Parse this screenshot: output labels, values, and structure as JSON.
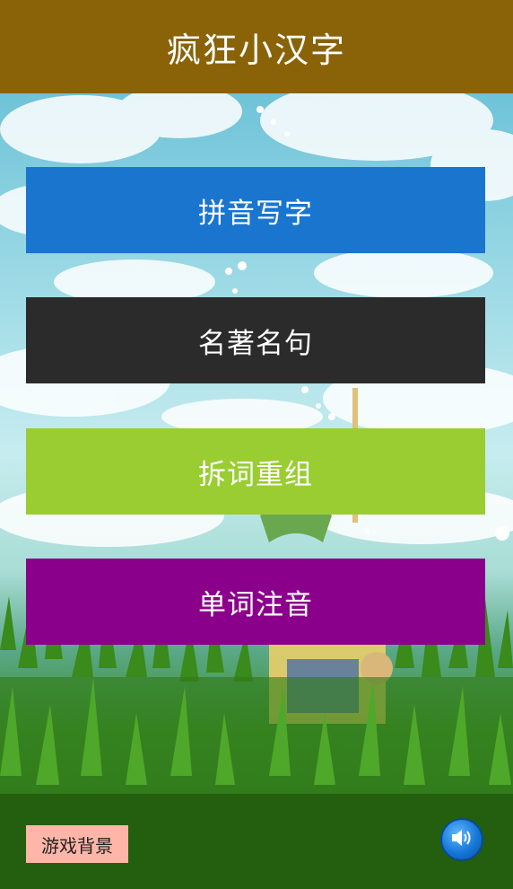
{
  "header": {
    "title": "疯狂小汉字",
    "color": "#8a6309"
  },
  "menu": {
    "items": [
      {
        "label": "拼音写字",
        "color": "#1a75cf"
      },
      {
        "label": "名著名句",
        "color": "#2b2b2b"
      },
      {
        "label": "拆词重组",
        "color": "#9acd32"
      },
      {
        "label": "单词注音",
        "color": "#8b008b"
      }
    ]
  },
  "footer": {
    "background_button_label": "游戏背景",
    "background_button_color": "#ffb6a8",
    "sound_icon": "speaker-volume-icon"
  }
}
